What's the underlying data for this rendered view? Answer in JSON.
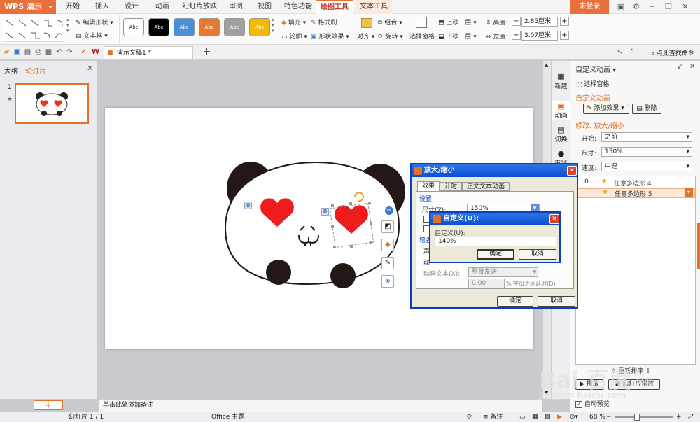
{
  "app": {
    "logo": "WPS 演示",
    "login": "未登录"
  },
  "menu": [
    "开始",
    "插入",
    "设计",
    "动画",
    "幻灯片放映",
    "审阅",
    "视图",
    "特色功能",
    "绘图工具",
    "文本工具"
  ],
  "menu_active_index": 8,
  "ribbon": {
    "edit_shape": "编辑形状",
    "textbox": "文本框",
    "style_swatches": [
      {
        "label": "Abc",
        "bg": "#ffffff",
        "fg": "#333333"
      },
      {
        "label": "Abc",
        "bg": "#000000",
        "fg": "#ffffff"
      },
      {
        "label": "Abc",
        "bg": "#4a90d9",
        "fg": "#ffffff"
      },
      {
        "label": "Abc",
        "bg": "#e9782f",
        "fg": "#ffffff"
      },
      {
        "label": "Abc",
        "bg": "#a0a0a0",
        "fg": "#ffffff"
      },
      {
        "label": "Abc",
        "bg": "#f5b800",
        "fg": "#ffffff"
      }
    ],
    "fill": "填充",
    "format_painter": "格式刷",
    "outline": "轮廓",
    "shape_effect": "形状效果",
    "align": "对齐",
    "group": "组合",
    "rotate": "旋转",
    "selection_pane": "选择窗格",
    "bring_forward": "上移一层",
    "send_backward": "下移一层",
    "height_label": "高度:",
    "height_value": "2.85厘米",
    "width_label": "宽度:",
    "width_value": "3.07厘米"
  },
  "quickbar": {
    "doc_tab": "演示文稿1 *",
    "find_command": "点此查找命令"
  },
  "left_panel": {
    "tab_outline": "大纲",
    "tab_slides": "幻灯片",
    "slide_number": "1",
    "add_slide": "+"
  },
  "notes_placeholder": "单击此处添加备注",
  "status": {
    "slide": "幻灯片 1 / 1",
    "theme": "Office 主题",
    "notes": "备注",
    "zoom": "68 %"
  },
  "slide_badges": [
    "0",
    "0"
  ],
  "side_tabs": [
    "新建",
    "动画",
    "切换",
    "形状"
  ],
  "right_panel": {
    "header": "自定义动画",
    "select_pane": "选择窗格",
    "section_title": "自定义动画",
    "add_effect": "添加效果",
    "delete": "删除",
    "modify": "修改: 放大/缩小",
    "start_label": "开始:",
    "start_value": "之前",
    "size_label": "尺寸:",
    "size_value": "150%",
    "speed_label": "速度:",
    "speed_value": "中速",
    "items": [
      {
        "index": "0",
        "name": "任意多边形 4"
      },
      {
        "index": "",
        "name": "任意多边形 5"
      }
    ],
    "reorder": "重新排序",
    "play": "播放",
    "slideshow": "幻灯片播放",
    "autopreview": "自动预览"
  },
  "dialog_main": {
    "title": "放大/缩小",
    "tabs": [
      "效果",
      "计时",
      "正文文本动画"
    ],
    "settings": "设置",
    "size_label": "尺寸(Z):",
    "size_value": "150%",
    "enhance": "增强",
    "sound_prefix": "声",
    "anim_prefix": "动",
    "anim_text_label": "动画文本(X):",
    "anim_text_value": "整批发送",
    "delay_value": "0.00",
    "delay_label": "% 字母之间延迟(D)",
    "ok": "确定",
    "cancel": "取消"
  },
  "dialog_custom": {
    "title": "自定义(U):",
    "label": "自定义(U):",
    "value": "140%",
    "ok": "确定",
    "cancel": "取消"
  },
  "watermark": {
    "brand": "Bai 百度",
    "sub": "经验",
    "url": "jingyan.baidu.com"
  }
}
